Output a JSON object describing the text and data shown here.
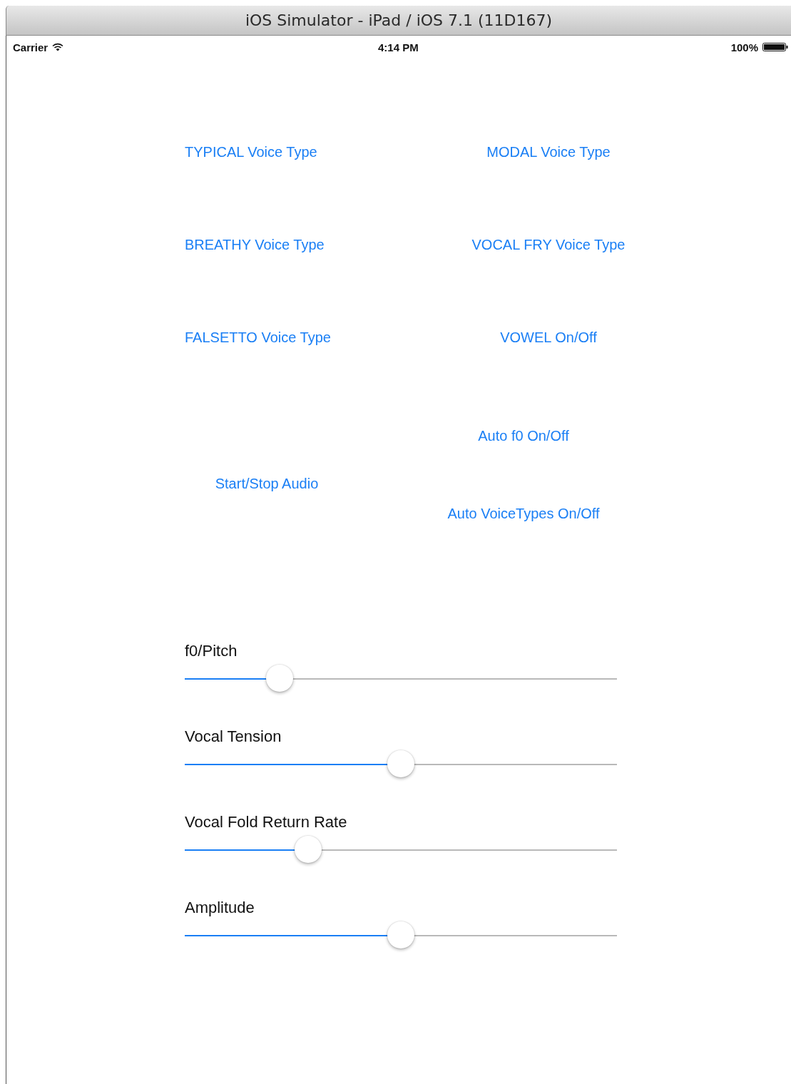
{
  "window": {
    "title": "iOS Simulator - iPad / iOS 7.1 (11D167)"
  },
  "status_bar": {
    "carrier": "Carrier",
    "time": "4:14 PM",
    "battery": "100%"
  },
  "button_rows": [
    {
      "left": "TYPICAL Voice Type",
      "right": "MODAL Voice Type"
    },
    {
      "left": "BREATHY Voice Type",
      "right": "VOCAL FRY Voice Type"
    },
    {
      "left": "FALSETTO Voice Type",
      "right": "VOWEL On/Off"
    }
  ],
  "audio_group": {
    "left": "Start/Stop Audio",
    "right": [
      "Auto f0 On/Off",
      "Auto VoiceTypes On/Off"
    ]
  },
  "sliders": [
    {
      "label": "f0/Pitch",
      "level": 0.22
    },
    {
      "label": "Vocal Tension",
      "level": 0.5
    },
    {
      "label": "Vocal Fold Return Rate",
      "level": 0.285
    },
    {
      "label": "Amplitude",
      "level": 0.5
    }
  ]
}
